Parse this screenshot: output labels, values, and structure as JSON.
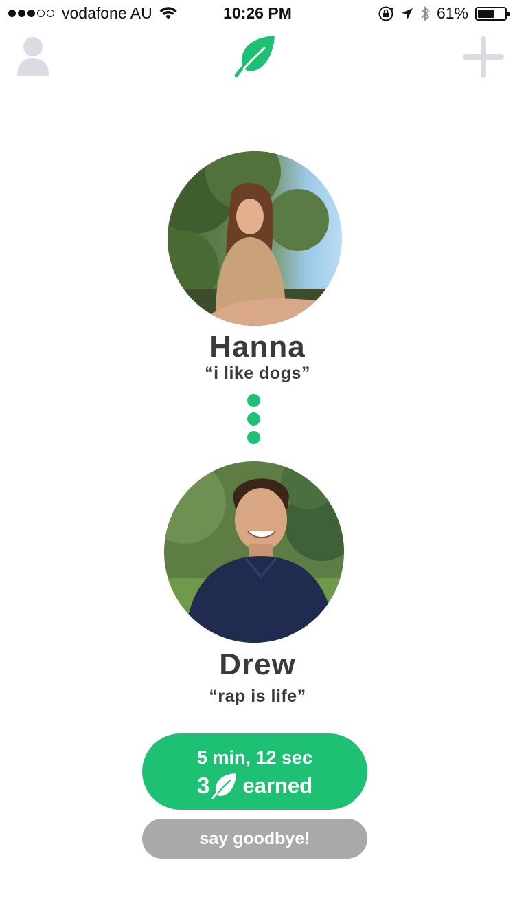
{
  "status_bar": {
    "carrier": "vodafone AU",
    "signal_bars_filled": 3,
    "signal_bars_total": 5,
    "time": "10:26 PM",
    "battery_percent_text": "61%",
    "battery_level": 0.61
  },
  "nav": {
    "profile_icon": "person-icon",
    "logo_icon": "leaf-icon",
    "add_icon": "plus-icon"
  },
  "match": {
    "person_a": {
      "name": "Hanna",
      "quote": "“i like dogs”"
    },
    "person_b": {
      "name": "Drew",
      "quote": "“rap is life”"
    }
  },
  "session": {
    "duration": "5 min, 12 sec",
    "leaves_earned": "3",
    "earned_label": "earned"
  },
  "actions": {
    "goodbye_label": "say goodbye!"
  },
  "colors": {
    "accent_green": "#1ec073",
    "neutral_gray": "#a9a9a9",
    "icon_gray": "#d9dde3"
  }
}
